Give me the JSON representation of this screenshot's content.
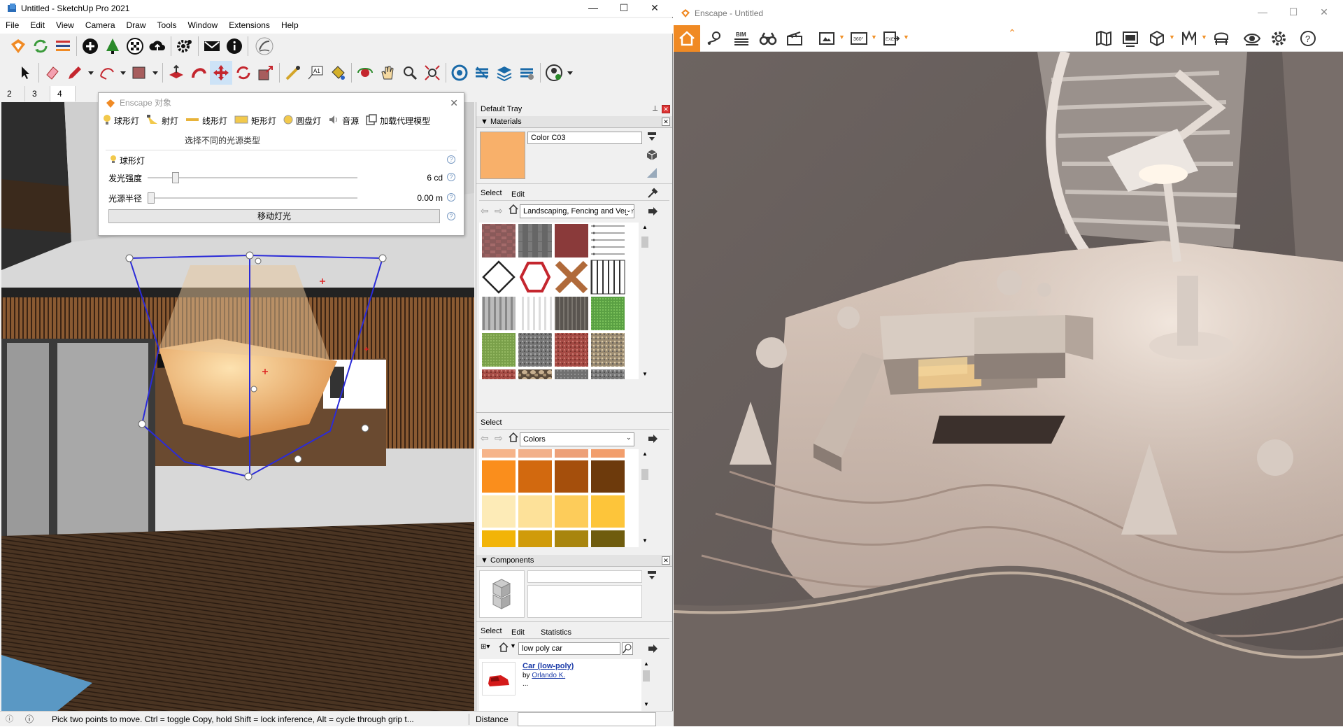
{
  "sketchup": {
    "window_title": "Untitled - SketchUp Pro 2021",
    "menu": [
      "File",
      "Edit",
      "View",
      "Camera",
      "Draw",
      "Tools",
      "Window",
      "Extensions",
      "Help"
    ],
    "scene_tabs": [
      "2",
      "3",
      "4"
    ],
    "status_text": "Pick two points to move.  Ctrl = toggle Copy, hold Shift = lock inference, Alt = cycle through grip t...",
    "distance_label": "Distance"
  },
  "enscape_objects": {
    "title": "Enscape 对象",
    "light_types": [
      "球形灯",
      "射灯",
      "线形灯",
      "矩形灯",
      "圆盘灯",
      "音源",
      "加载代理模型"
    ],
    "hint": "选择不同的光源类型",
    "section_label": "球形灯",
    "intensity_label": "发光强度",
    "intensity_value": "6 cd",
    "intensity_level": 0.12,
    "radius_label": "光源半径",
    "radius_value": "0.00 m",
    "radius_level": 0.0,
    "move_button": "移动灯光"
  },
  "tray": {
    "title": "Default Tray",
    "materials": {
      "header": "Materials",
      "current_name": "Color C03",
      "current_color": "#f8b06a",
      "tab_select": "Select",
      "tab_edit": "Edit",
      "library": "Landscaping, Fencing and Vegetation",
      "select2_label": "Select",
      "library2": "Colors",
      "color_rows": [
        [
          "#f6b48a",
          "#f2b08a",
          "#eda078",
          "#f29e6c"
        ],
        [
          "#fa8e1c",
          "#d2690f",
          "#a54f0c",
          "#6d3a0c"
        ],
        [
          "#fdebb7",
          "#fde199",
          "#fdcc5a",
          "#fdc53a"
        ],
        [
          "#f2b408",
          "#d09b0a",
          "#a8850e",
          "#6f5c0e"
        ]
      ]
    },
    "components": {
      "header": "Components",
      "tab_select": "Select",
      "tab_edit": "Edit",
      "tab_statistics": "Statistics",
      "search_value": "low poly car",
      "result_title": "Car (low-poly)",
      "result_by": "by",
      "result_author": "Orlando K.",
      "result_more": "..."
    }
  },
  "enscape": {
    "window_title": "Enscape - Untitled",
    "bim_label": "BIM",
    "accent": "#f08a24"
  }
}
